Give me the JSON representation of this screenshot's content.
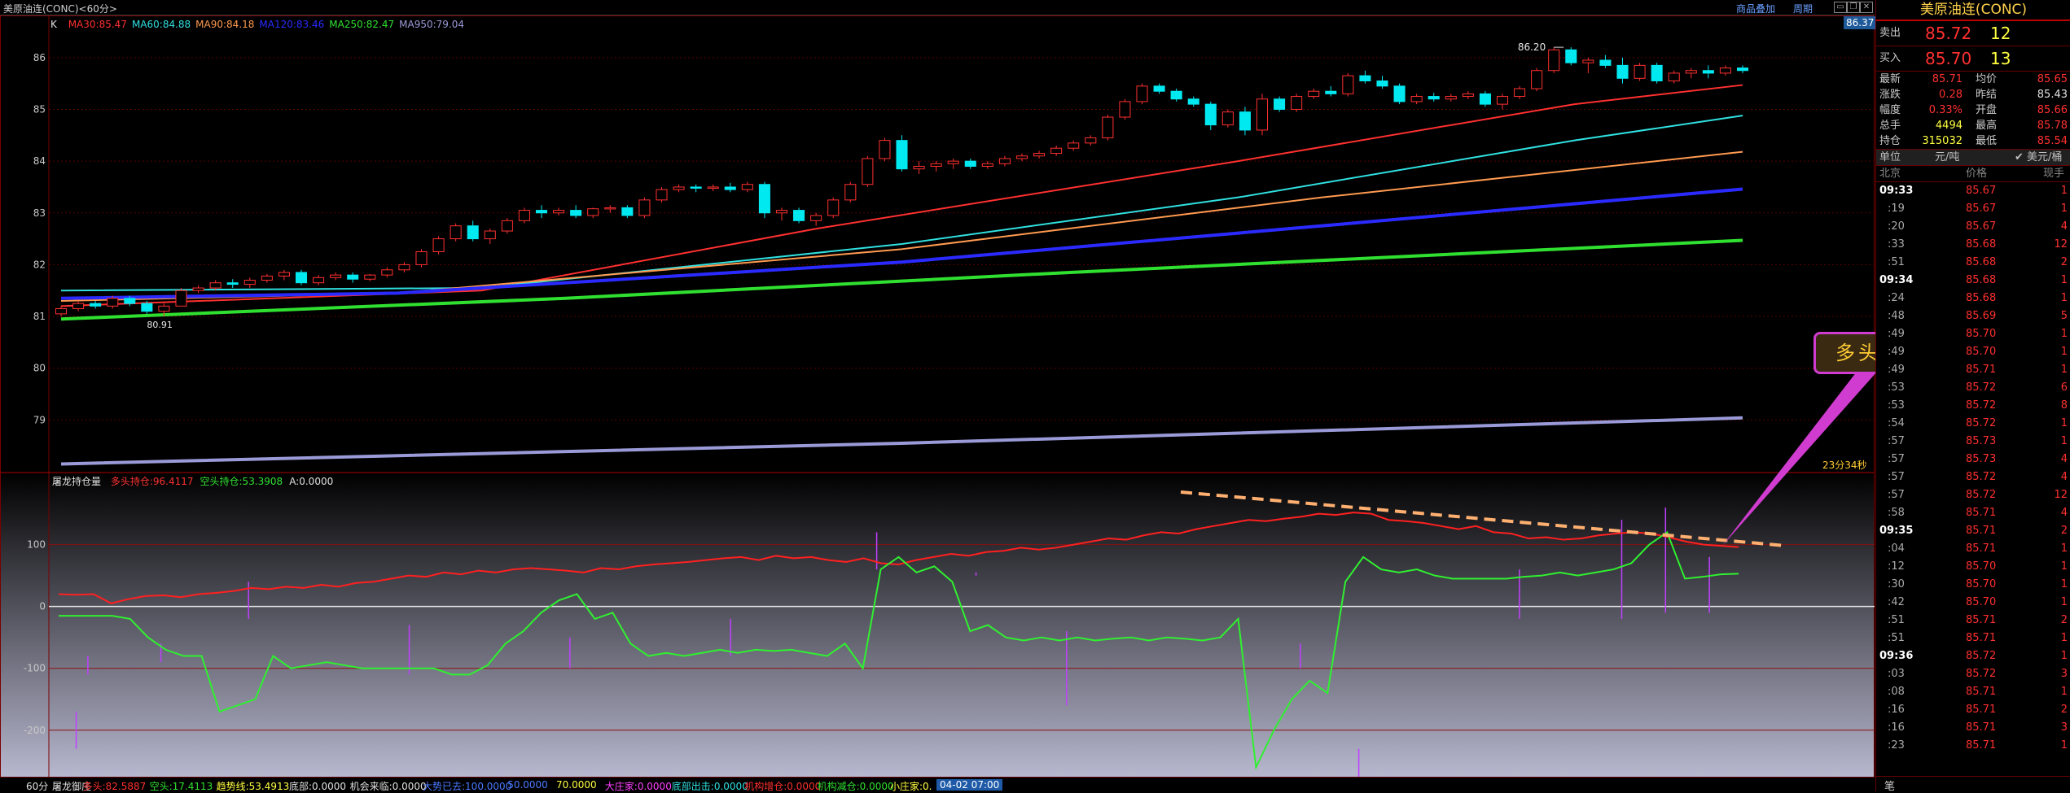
{
  "window": {
    "title": "美原油连(CONC)<60分>",
    "menu_variety": "商品叠加",
    "menu_period": "周期"
  },
  "price_panel": {
    "k_label": "K",
    "ma_legend": [
      {
        "text": "MA30:85.47",
        "color": "#ff3030"
      },
      {
        "text": "MA60:84.88",
        "color": "#30e0e0"
      },
      {
        "text": "MA90:84.18",
        "color": "#ff9a50"
      },
      {
        "text": "MA120:83.46",
        "color": "#2a2aff"
      },
      {
        "text": "MA250:82.47",
        "color": "#30e030"
      },
      {
        "text": "MA950:79.04",
        "color": "#9a9ad8"
      }
    ],
    "last_price_badge": "86.37",
    "high_marker": "86.20",
    "low_marker": "80.91",
    "y_ticks": [
      "86",
      "85",
      "84",
      "83",
      "82",
      "81",
      "80",
      "79"
    ],
    "timer_text": "23分34秒"
  },
  "indicator_panel": {
    "name": "屠龙持仓量",
    "legend": [
      {
        "text": "多头持仓:96.4117",
        "color": "#ff3030"
      },
      {
        "text": "空头持仓:53.3908",
        "color": "#30e030"
      },
      {
        "text": "A:0.0000",
        "color": "#e0e0e0"
      }
    ],
    "y_ticks": [
      "100",
      "0",
      "-100",
      "-200"
    ]
  },
  "annotation": {
    "text": "多头主力继续减仓"
  },
  "bottom_strip": {
    "period": "60分",
    "items": [
      {
        "text": "屠龙御庄",
        "color": "#e0e0e0"
      },
      {
        "text": "多头:82.5887",
        "color": "#ff3030"
      },
      {
        "text": "空头:17.4113",
        "color": "#30e030"
      },
      {
        "text": "趋势线:53.4913",
        "color": "#ffff40"
      },
      {
        "text": "底部:0.0000",
        "color": "#e0e0e0"
      },
      {
        "text": "机会来临:0.0000",
        "color": "#e0e0e0"
      },
      {
        "text": "大势已去:100.0000",
        "color": "#4a7aff"
      },
      {
        "text": "50.0000",
        "color": "#4a7aff"
      },
      {
        "text": "70.0000",
        "color": "#ffff40"
      },
      {
        "text": "大庄家:0.0000",
        "color": "#ff40ff"
      },
      {
        "text": "底部出击:0.0000",
        "color": "#30e0e0"
      },
      {
        "text": "机构增仓:0.0000",
        "color": "#ff3030"
      },
      {
        "text": "机构减仓:0.0000",
        "color": "#30e030"
      },
      {
        "text": "小庄家:0.",
        "color": "#ffff40"
      }
    ],
    "date_badge": "04-02 07:00"
  },
  "quote": {
    "name": "美原油连(CONC)",
    "sell_label": "卖出",
    "sell_price": "85.72",
    "sell_vol": "12",
    "buy_label": "买入",
    "buy_price": "85.70",
    "buy_vol": "13",
    "stats": [
      {
        "l1": "最新",
        "v1": "85.71",
        "c1": "#ff3030",
        "l2": "均价",
        "v2": "85.65",
        "c2": "#ff3030"
      },
      {
        "l1": "涨跌",
        "v1": "0.28",
        "c1": "#ff3030",
        "l2": "昨结",
        "v2": "85.43",
        "c2": "#e0e0e0"
      },
      {
        "l1": "幅度",
        "v1": "0.33%",
        "c1": "#ff3030",
        "l2": "开盘",
        "v2": "85.66",
        "c2": "#ff3030"
      },
      {
        "l1": "总手",
        "v1": "4494",
        "c1": "#ffff40",
        "l2": "最高",
        "v2": "85.78",
        "c2": "#ff3030"
      },
      {
        "l1": "持仓",
        "v1": "315032",
        "c1": "#ffff40",
        "l2": "最低",
        "v2": "85.54",
        "c2": "#ff3030"
      }
    ],
    "unit_label": "单位",
    "unit_value": "元/吨",
    "unit_check": "✔ 美元/桶",
    "col_time": "北京",
    "col_price": "价格",
    "col_vol": "现手",
    "ticks": [
      {
        "t": "09:33",
        "p": "85.67",
        "v": "1",
        "bold": true
      },
      {
        "t": ":19",
        "p": "85.67",
        "v": "1"
      },
      {
        "t": ":20",
        "p": "85.67",
        "v": "4"
      },
      {
        "t": ":33",
        "p": "85.68",
        "v": "12"
      },
      {
        "t": ":51",
        "p": "85.68",
        "v": "2"
      },
      {
        "t": "09:34",
        "p": "85.68",
        "v": "1",
        "bold": true
      },
      {
        "t": ":24",
        "p": "85.68",
        "v": "1"
      },
      {
        "t": ":48",
        "p": "85.69",
        "v": "5"
      },
      {
        "t": ":49",
        "p": "85.70",
        "v": "1"
      },
      {
        "t": ":49",
        "p": "85.70",
        "v": "1"
      },
      {
        "t": ":49",
        "p": "85.71",
        "v": "1"
      },
      {
        "t": ":53",
        "p": "85.72",
        "v": "6"
      },
      {
        "t": ":53",
        "p": "85.72",
        "v": "8"
      },
      {
        "t": ":54",
        "p": "85.72",
        "v": "1"
      },
      {
        "t": ":57",
        "p": "85.73",
        "v": "1"
      },
      {
        "t": ":57",
        "p": "85.73",
        "v": "4"
      },
      {
        "t": ":57",
        "p": "85.72",
        "v": "4"
      },
      {
        "t": ":57",
        "p": "85.72",
        "v": "12"
      },
      {
        "t": ":58",
        "p": "85.71",
        "v": "4"
      },
      {
        "t": "09:35",
        "p": "85.71",
        "v": "2",
        "bold": true
      },
      {
        "t": ":04",
        "p": "85.71",
        "v": "1"
      },
      {
        "t": ":12",
        "p": "85.70",
        "v": "1"
      },
      {
        "t": ":30",
        "p": "85.70",
        "v": "1"
      },
      {
        "t": ":42",
        "p": "85.70",
        "v": "1"
      },
      {
        "t": ":51",
        "p": "85.71",
        "v": "2"
      },
      {
        "t": ":51",
        "p": "85.71",
        "v": "1"
      },
      {
        "t": "09:36",
        "p": "85.72",
        "v": "1",
        "bold": true
      },
      {
        "t": ":03",
        "p": "85.72",
        "v": "3"
      },
      {
        "t": ":08",
        "p": "85.71",
        "v": "1"
      },
      {
        "t": ":16",
        "p": "85.71",
        "v": "2"
      },
      {
        "t": ":16",
        "p": "85.71",
        "v": "3"
      },
      {
        "t": ":23",
        "p": "85.71",
        "v": "1"
      }
    ],
    "footer_tab": "笔"
  },
  "colors": {
    "up": "#ff3030",
    "down": "#00e8f0",
    "grid": "#5a0000",
    "long_line": "#ff2020",
    "short_line": "#30f030",
    "trend_dash": "#ffb070"
  },
  "chart_data": {
    "type": "line",
    "note_series": "candles approximated from visible chart",
    "price_candles": [
      [
        81.05,
        81.2,
        81.0,
        81.15
      ],
      [
        81.15,
        81.3,
        81.1,
        81.25
      ],
      [
        81.25,
        81.3,
        81.15,
        81.2
      ],
      [
        81.2,
        81.4,
        81.15,
        81.35
      ],
      [
        81.35,
        81.4,
        81.2,
        81.25
      ],
      [
        81.25,
        81.3,
        81.05,
        81.1
      ],
      [
        81.1,
        81.25,
        81.0,
        81.2
      ],
      [
        81.2,
        81.55,
        81.2,
        81.5
      ],
      [
        81.5,
        81.6,
        81.45,
        81.55
      ],
      [
        81.55,
        81.7,
        81.5,
        81.65
      ],
      [
        81.65,
        81.72,
        81.55,
        81.62
      ],
      [
        81.62,
        81.75,
        81.55,
        81.7
      ],
      [
        81.7,
        81.82,
        81.65,
        81.78
      ],
      [
        81.78,
        81.9,
        81.7,
        81.85
      ],
      [
        81.85,
        81.9,
        81.6,
        81.65
      ],
      [
        81.65,
        81.8,
        81.6,
        81.75
      ],
      [
        81.75,
        81.85,
        81.7,
        81.8
      ],
      [
        81.8,
        81.85,
        81.65,
        81.72
      ],
      [
        81.72,
        81.82,
        81.68,
        81.8
      ],
      [
        81.8,
        81.95,
        81.75,
        81.9
      ],
      [
        81.9,
        82.05,
        81.85,
        82.0
      ],
      [
        82.0,
        82.3,
        81.95,
        82.25
      ],
      [
        82.25,
        82.55,
        82.2,
        82.5
      ],
      [
        82.5,
        82.8,
        82.45,
        82.75
      ],
      [
        82.75,
        82.85,
        82.45,
        82.5
      ],
      [
        82.5,
        82.7,
        82.4,
        82.65
      ],
      [
        82.65,
        82.9,
        82.6,
        82.85
      ],
      [
        82.85,
        83.1,
        82.8,
        83.05
      ],
      [
        83.05,
        83.15,
        82.9,
        83.0
      ],
      [
        83.0,
        83.1,
        82.95,
        83.05
      ],
      [
        83.05,
        83.15,
        82.9,
        82.95
      ],
      [
        82.95,
        83.1,
        82.9,
        83.08
      ],
      [
        83.08,
        83.15,
        83.0,
        83.1
      ],
      [
        83.1,
        83.15,
        82.9,
        82.95
      ],
      [
        82.95,
        83.3,
        82.9,
        83.25
      ],
      [
        83.25,
        83.5,
        83.2,
        83.45
      ],
      [
        83.45,
        83.55,
        83.4,
        83.5
      ],
      [
        83.5,
        83.55,
        83.4,
        83.48
      ],
      [
        83.48,
        83.55,
        83.42,
        83.5
      ],
      [
        83.5,
        83.58,
        83.4,
        83.45
      ],
      [
        83.45,
        83.6,
        83.4,
        83.55
      ],
      [
        83.55,
        83.6,
        82.9,
        83.0
      ],
      [
        83.0,
        83.1,
        82.85,
        83.05
      ],
      [
        83.05,
        83.1,
        82.8,
        82.85
      ],
      [
        82.85,
        83.0,
        82.75,
        82.95
      ],
      [
        82.95,
        83.3,
        82.9,
        83.25
      ],
      [
        83.25,
        83.6,
        83.2,
        83.55
      ],
      [
        83.55,
        84.1,
        83.5,
        84.05
      ],
      [
        84.05,
        84.45,
        84.0,
        84.4
      ],
      [
        84.4,
        84.5,
        83.8,
        83.85
      ],
      [
        83.85,
        84.0,
        83.75,
        83.9
      ],
      [
        83.9,
        84.0,
        83.8,
        83.95
      ],
      [
        83.95,
        84.05,
        83.85,
        84.0
      ],
      [
        84.0,
        84.05,
        83.85,
        83.9
      ],
      [
        83.9,
        84.0,
        83.85,
        83.95
      ],
      [
        83.95,
        84.1,
        83.9,
        84.05
      ],
      [
        84.05,
        84.15,
        84.0,
        84.1
      ],
      [
        84.1,
        84.2,
        84.05,
        84.15
      ],
      [
        84.15,
        84.3,
        84.1,
        84.25
      ],
      [
        84.25,
        84.4,
        84.2,
        84.35
      ],
      [
        84.35,
        84.5,
        84.3,
        84.45
      ],
      [
        84.45,
        84.9,
        84.4,
        84.85
      ],
      [
        84.85,
        85.2,
        84.8,
        85.15
      ],
      [
        85.15,
        85.5,
        85.1,
        85.45
      ],
      [
        85.45,
        85.5,
        85.3,
        85.35
      ],
      [
        85.35,
        85.4,
        85.15,
        85.2
      ],
      [
        85.2,
        85.25,
        85.05,
        85.1
      ],
      [
        85.1,
        85.15,
        84.6,
        84.7
      ],
      [
        84.7,
        85.0,
        84.65,
        84.95
      ],
      [
        84.95,
        85.05,
        84.5,
        84.6
      ],
      [
        84.6,
        85.3,
        84.5,
        85.2
      ],
      [
        85.2,
        85.25,
        84.95,
        85.0
      ],
      [
        85.0,
        85.3,
        84.95,
        85.25
      ],
      [
        85.25,
        85.4,
        85.2,
        85.35
      ],
      [
        85.35,
        85.45,
        85.25,
        85.3
      ],
      [
        85.3,
        85.7,
        85.25,
        85.65
      ],
      [
        85.65,
        85.75,
        85.5,
        85.55
      ],
      [
        85.55,
        85.65,
        85.4,
        85.45
      ],
      [
        85.45,
        85.5,
        85.1,
        85.15
      ],
      [
        85.15,
        85.3,
        85.1,
        85.25
      ],
      [
        85.25,
        85.32,
        85.15,
        85.2
      ],
      [
        85.2,
        85.3,
        85.15,
        85.25
      ],
      [
        85.25,
        85.35,
        85.2,
        85.3
      ],
      [
        85.3,
        85.35,
        85.05,
        85.1
      ],
      [
        85.1,
        85.3,
        85.0,
        85.25
      ],
      [
        85.25,
        85.45,
        85.2,
        85.4
      ],
      [
        85.4,
        85.8,
        85.35,
        85.75
      ],
      [
        85.75,
        86.2,
        85.7,
        86.15
      ],
      [
        86.15,
        86.2,
        85.85,
        85.9
      ],
      [
        85.9,
        86.0,
        85.7,
        85.95
      ],
      [
        85.95,
        86.05,
        85.8,
        85.85
      ],
      [
        85.85,
        86.0,
        85.5,
        85.6
      ],
      [
        85.6,
        85.9,
        85.55,
        85.85
      ],
      [
        85.85,
        85.9,
        85.5,
        85.55
      ],
      [
        85.55,
        85.75,
        85.5,
        85.7
      ],
      [
        85.7,
        85.8,
        85.6,
        85.75
      ],
      [
        85.75,
        85.85,
        85.6,
        85.7
      ],
      [
        85.7,
        85.85,
        85.65,
        85.8
      ],
      [
        85.8,
        85.85,
        85.7,
        85.75
      ]
    ],
    "ma_series": [
      {
        "name": "MA30",
        "color": "#ff3030",
        "pts": [
          [
            0,
            81.2
          ],
          [
            25,
            81.5
          ],
          [
            45,
            82.7
          ],
          [
            70,
            84.0
          ],
          [
            90,
            85.1
          ],
          [
            100,
            85.47
          ]
        ]
      },
      {
        "name": "MA60",
        "color": "#30e0e0",
        "pts": [
          [
            0,
            81.5
          ],
          [
            25,
            81.55
          ],
          [
            50,
            82.4
          ],
          [
            70,
            83.3
          ],
          [
            90,
            84.4
          ],
          [
            100,
            84.88
          ]
        ]
      },
      {
        "name": "MA90",
        "color": "#ff9a50",
        "pts": [
          [
            0,
            81.3
          ],
          [
            20,
            81.45
          ],
          [
            50,
            82.3
          ],
          [
            75,
            83.3
          ],
          [
            100,
            84.18
          ]
        ]
      },
      {
        "name": "MA120",
        "color": "#2a2aff",
        "pts": [
          [
            0,
            81.35
          ],
          [
            20,
            81.45
          ],
          [
            50,
            82.05
          ],
          [
            75,
            82.75
          ],
          [
            100,
            83.46
          ]
        ]
      },
      {
        "name": "MA250",
        "color": "#30e030",
        "pts": [
          [
            0,
            80.95
          ],
          [
            30,
            81.35
          ],
          [
            60,
            81.85
          ],
          [
            100,
            82.47
          ]
        ]
      },
      {
        "name": "MA950",
        "color": "#9a9ad8",
        "pts": [
          [
            0,
            78.15
          ],
          [
            50,
            78.55
          ],
          [
            100,
            79.04
          ]
        ]
      }
    ],
    "long_position": [
      20,
      19,
      20,
      5,
      12,
      17,
      18,
      15,
      20,
      22,
      25,
      30,
      28,
      32,
      30,
      35,
      32,
      38,
      40,
      45,
      50,
      48,
      55,
      52,
      58,
      55,
      60,
      62,
      60,
      58,
      55,
      62,
      60,
      65,
      68,
      70,
      72,
      75,
      78,
      80,
      75,
      82,
      78,
      80,
      75,
      72,
      78,
      70,
      68,
      75,
      80,
      85,
      82,
      88,
      90,
      95,
      92,
      95,
      100,
      105,
      110,
      108,
      115,
      120,
      118,
      125,
      130,
      135,
      140,
      138,
      142,
      145,
      150,
      148,
      152,
      150,
      140,
      138,
      135,
      130,
      125,
      130,
      120,
      118,
      110,
      112,
      108,
      110,
      115,
      118,
      120,
      118,
      112,
      105,
      100,
      98,
      96
    ],
    "short_position": [
      -15,
      -15,
      -15,
      -15,
      -20,
      -50,
      -70,
      -80,
      -80,
      -170,
      -160,
      -150,
      -80,
      -100,
      -95,
      -90,
      -95,
      -100,
      -100,
      -100,
      -100,
      -100,
      -110,
      -110,
      -95,
      -60,
      -40,
      -10,
      10,
      20,
      -20,
      -10,
      -60,
      -80,
      -75,
      -80,
      -75,
      -70,
      -75,
      -70,
      -72,
      -70,
      -75,
      -80,
      -60,
      -100,
      60,
      80,
      55,
      65,
      40,
      -40,
      -30,
      -50,
      -55,
      -50,
      -55,
      -50,
      -55,
      -52,
      -50,
      -55,
      -50,
      -52,
      -55,
      -50,
      -20,
      -260,
      -200,
      -150,
      -120,
      -140,
      40,
      80,
      60,
      55,
      60,
      50,
      45,
      45,
      45,
      45,
      48,
      50,
      55,
      50,
      55,
      60,
      70,
      100,
      120,
      45,
      48,
      52,
      53
    ],
    "ylim_price": [
      78,
      86.5
    ],
    "ylim_indicator": [
      -270,
      185
    ]
  }
}
